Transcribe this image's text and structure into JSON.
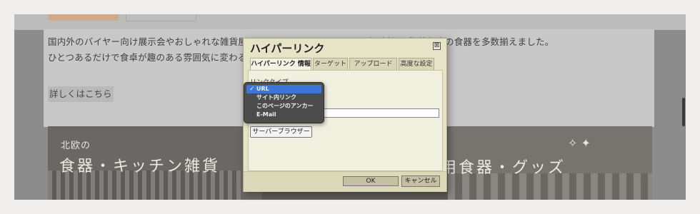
{
  "article": {
    "line1": "国内外のバイヤー向け展示会やおしゃれな雑貨屋さん、食器好きの人だけの間をしばって話題の陶芸作家の食器を多数揃えました。",
    "line1_visible": "国内外のバイヤー向け展示会やおしゃれな雑貨屋さ",
    "line1_visible_right": "ずで話題の陶芸作家の食器を多数揃えました。",
    "line2": "ひとつあるだけで食卓が趣のある雰囲気に変わる雑",
    "more_link": "詳しくはこちら"
  },
  "banner": {
    "subtitle": "北欧の",
    "left_title": "食器・キッチン雑貨",
    "right_title": "用食器・グッズ"
  },
  "dialog": {
    "title": "ハイパーリンク",
    "close_symbol": "⊠",
    "tabs": [
      {
        "label": "ハイパーリンク 情報"
      },
      {
        "label": "ターゲット"
      },
      {
        "label": "アップロード"
      },
      {
        "label": "高度な設定"
      }
    ],
    "link_type_label": "リンクタイプ",
    "browse_button": "サーバーブラウザー",
    "ok_button": "OK",
    "cancel_button": "キャンセル"
  },
  "dropdown": {
    "options": [
      {
        "label": "URL",
        "selected": true,
        "check": "✓"
      },
      {
        "label": "サイト内リンク",
        "selected": false
      },
      {
        "label": "このページのアンカー",
        "selected": false
      },
      {
        "label": "E-Mail",
        "selected": false
      }
    ]
  },
  "colors": {
    "dialog_bg": "#e6e3c7",
    "selection": "#3d76d8",
    "overlay": "#8c8c8c"
  }
}
